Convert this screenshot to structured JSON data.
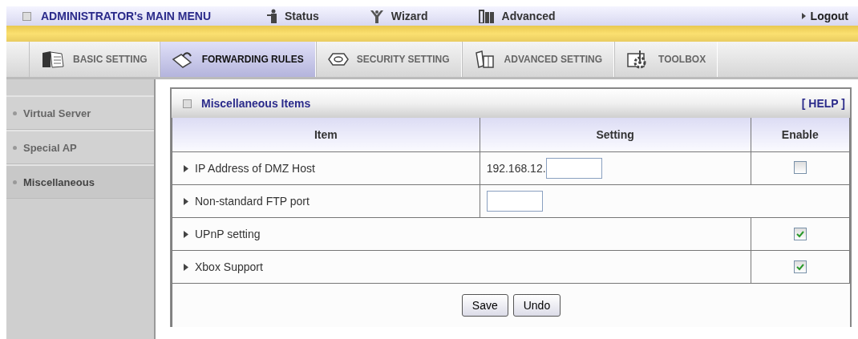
{
  "top_menu": {
    "title": "ADMINISTRATOR's MAIN MENU",
    "items": [
      {
        "kind": "status",
        "label": "Status"
      },
      {
        "kind": "wizard",
        "label": "Wizard"
      },
      {
        "kind": "advanced",
        "label": "Advanced"
      }
    ],
    "logout": "Logout"
  },
  "tabs": [
    {
      "kind": "basic",
      "label": "BASIC SETTING",
      "selected": false
    },
    {
      "kind": "forwarding",
      "label": "FORWARDING RULES",
      "selected": true
    },
    {
      "kind": "security",
      "label": "SECURITY SETTING",
      "selected": false
    },
    {
      "kind": "advanced",
      "label": "ADVANCED SETTING",
      "selected": false
    },
    {
      "kind": "toolbox",
      "label": "TOOLBOX",
      "selected": false
    }
  ],
  "sidebar": {
    "items": [
      {
        "label": "Virtual Server",
        "selected": false
      },
      {
        "label": "Special AP",
        "selected": false
      },
      {
        "label": "Miscellaneous",
        "selected": true
      }
    ]
  },
  "panel": {
    "title": "Miscellaneous Items",
    "help": "[ HELP ]",
    "columns": [
      "Item",
      "Setting",
      "Enable"
    ],
    "rows": [
      {
        "kind": "ip",
        "item": "IP Address of DMZ Host",
        "prefix": "192.168.12.",
        "checked": false
      },
      {
        "kind": "input",
        "item": "Non-standard FTP port"
      },
      {
        "kind": "check",
        "item": "UPnP setting",
        "checked": true
      },
      {
        "kind": "check",
        "item": "Xbox Support",
        "checked": true
      }
    ],
    "buttons": [
      "Save",
      "Undo"
    ]
  }
}
